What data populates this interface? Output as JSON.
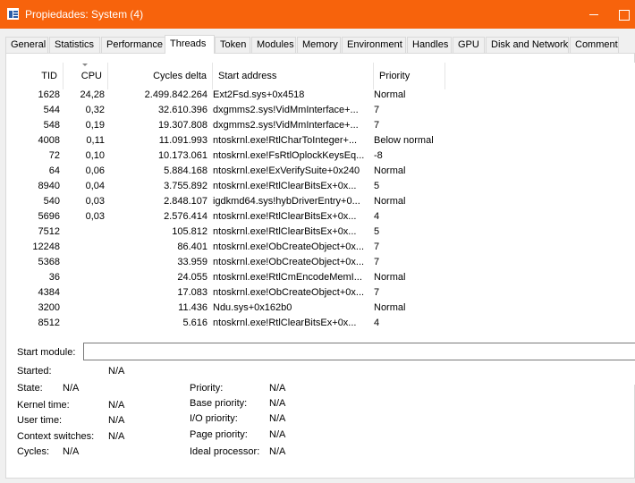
{
  "window": {
    "title": "Propiedades: System (4)"
  },
  "tabs": [
    {
      "label": "General"
    },
    {
      "label": "Statistics"
    },
    {
      "label": "Performance"
    },
    {
      "label": "Threads"
    },
    {
      "label": "Token"
    },
    {
      "label": "Modules"
    },
    {
      "label": "Memory"
    },
    {
      "label": "Environment"
    },
    {
      "label": "Handles"
    },
    {
      "label": "GPU"
    },
    {
      "label": "Disk and Network"
    },
    {
      "label": "Comment"
    }
  ],
  "active_tab": "Threads",
  "threads": {
    "columns": {
      "tid": "TID",
      "cpu": "CPU",
      "cycles": "Cycles delta",
      "address": "Start address",
      "priority": "Priority"
    },
    "sort_column": "CPU",
    "rows": [
      {
        "tid": "1628",
        "cpu": "24,28",
        "cycles": "2.499.842.264",
        "address": "Ext2Fsd.sys+0x4518",
        "priority": "Normal"
      },
      {
        "tid": "544",
        "cpu": "0,32",
        "cycles": "32.610.396",
        "address": "dxgmms2.sys!VidMmInterface+...",
        "priority": "7"
      },
      {
        "tid": "548",
        "cpu": "0,19",
        "cycles": "19.307.808",
        "address": "dxgmms2.sys!VidMmInterface+...",
        "priority": "7"
      },
      {
        "tid": "4008",
        "cpu": "0,11",
        "cycles": "11.091.993",
        "address": "ntoskrnl.exe!RtlCharToInteger+...",
        "priority": "Below normal"
      },
      {
        "tid": "72",
        "cpu": "0,10",
        "cycles": "10.173.061",
        "address": "ntoskrnl.exe!FsRtlOplockKeysEq...",
        "priority": "-8"
      },
      {
        "tid": "64",
        "cpu": "0,06",
        "cycles": "5.884.168",
        "address": "ntoskrnl.exe!ExVerifySuite+0x240",
        "priority": "Normal"
      },
      {
        "tid": "8940",
        "cpu": "0,04",
        "cycles": "3.755.892",
        "address": "ntoskrnl.exe!RtlClearBitsEx+0x...",
        "priority": "5"
      },
      {
        "tid": "540",
        "cpu": "0,03",
        "cycles": "2.848.107",
        "address": "igdkmd64.sys!hybDriverEntry+0...",
        "priority": "Normal"
      },
      {
        "tid": "5696",
        "cpu": "0,03",
        "cycles": "2.576.414",
        "address": "ntoskrnl.exe!RtlClearBitsEx+0x...",
        "priority": "4"
      },
      {
        "tid": "7512",
        "cpu": "",
        "cycles": "105.812",
        "address": "ntoskrnl.exe!RtlClearBitsEx+0x...",
        "priority": "5"
      },
      {
        "tid": "12248",
        "cpu": "",
        "cycles": "86.401",
        "address": "ntoskrnl.exe!ObCreateObject+0x...",
        "priority": "7"
      },
      {
        "tid": "5368",
        "cpu": "",
        "cycles": "33.959",
        "address": "ntoskrnl.exe!ObCreateObject+0x...",
        "priority": "7"
      },
      {
        "tid": "36",
        "cpu": "",
        "cycles": "24.055",
        "address": "ntoskrnl.exe!RtlCmEncodeMemI...",
        "priority": "Normal"
      },
      {
        "tid": "4384",
        "cpu": "",
        "cycles": "17.083",
        "address": "ntoskrnl.exe!ObCreateObject+0x...",
        "priority": "7"
      },
      {
        "tid": "3200",
        "cpu": "",
        "cycles": "11.436",
        "address": "Ndu.sys+0x162b0",
        "priority": "Normal"
      },
      {
        "tid": "8512",
        "cpu": "",
        "cycles": "5.616",
        "address": "ntoskrnl.exe!RtlClearBitsEx+0x...",
        "priority": "4"
      }
    ]
  },
  "details": {
    "start_module_label": "Start module:",
    "start_module_value": "",
    "started_label": "Started:",
    "started_value": "N/A",
    "state_label": "State:",
    "state_value": "N/A",
    "kernel_time_label": "Kernel time:",
    "kernel_time_value": "N/A",
    "user_time_label": "User time:",
    "user_time_value": "N/A",
    "context_switches_label": "Context switches:",
    "context_switches_value": "N/A",
    "cycles_label": "Cycles:",
    "cycles_value": "N/A",
    "priority_label": "Priority:",
    "priority_value": "N/A",
    "base_priority_label": "Base priority:",
    "base_priority_value": "N/A",
    "io_priority_label": "I/O priority:",
    "io_priority_value": "N/A",
    "page_priority_label": "Page priority:",
    "page_priority_value": "N/A",
    "ideal_processor_label": "Ideal processor:",
    "ideal_processor_value": "N/A"
  },
  "colors": {
    "titlebar": "#f7630c",
    "panel": "#ffffff",
    "background": "#f0f0f0"
  },
  "icons": {
    "window": "process-window-icon"
  }
}
